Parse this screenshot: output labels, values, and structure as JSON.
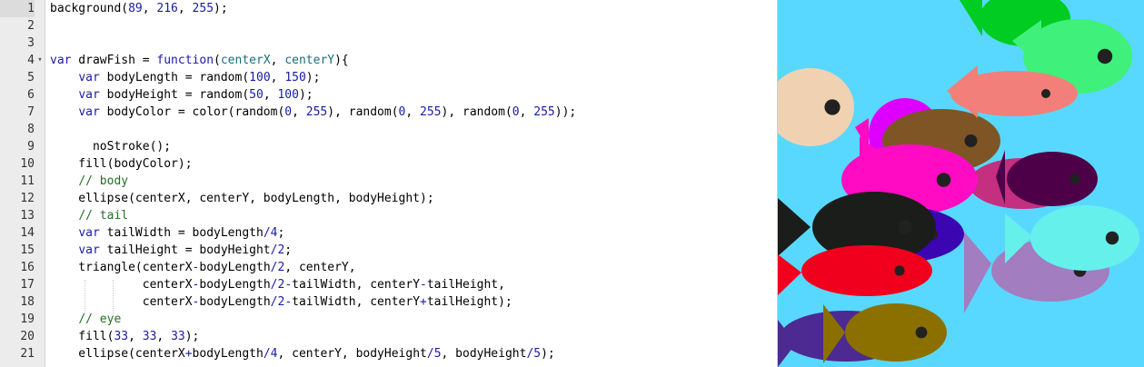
{
  "editor": {
    "active_line": 1,
    "lines": [
      {
        "n": "1",
        "tokens": [
          {
            "t": "background(",
            "c": ""
          },
          {
            "t": "89",
            "c": "num"
          },
          {
            "t": ", ",
            "c": ""
          },
          {
            "t": "216",
            "c": "num"
          },
          {
            "t": ", ",
            "c": ""
          },
          {
            "t": "255",
            "c": "num"
          },
          {
            "t": ");",
            "c": ""
          }
        ]
      },
      {
        "n": "2",
        "tokens": []
      },
      {
        "n": "3",
        "tokens": []
      },
      {
        "n": "4",
        "fold": "▾",
        "tokens": [
          {
            "t": "var",
            "c": "kw"
          },
          {
            "t": " drawFish = ",
            "c": ""
          },
          {
            "t": "function",
            "c": "kw"
          },
          {
            "t": "(",
            "c": ""
          },
          {
            "t": "centerX",
            "c": "param"
          },
          {
            "t": ", ",
            "c": ""
          },
          {
            "t": "centerY",
            "c": "param"
          },
          {
            "t": "){",
            "c": ""
          }
        ]
      },
      {
        "n": "5",
        "tokens": [
          {
            "t": "    ",
            "c": ""
          },
          {
            "t": "var",
            "c": "kw"
          },
          {
            "t": " bodyLength = random(",
            "c": ""
          },
          {
            "t": "100",
            "c": "num"
          },
          {
            "t": ", ",
            "c": ""
          },
          {
            "t": "150",
            "c": "num"
          },
          {
            "t": ");",
            "c": ""
          }
        ]
      },
      {
        "n": "6",
        "tokens": [
          {
            "t": "    ",
            "c": ""
          },
          {
            "t": "var",
            "c": "kw"
          },
          {
            "t": " bodyHeight = random(",
            "c": ""
          },
          {
            "t": "50",
            "c": "num"
          },
          {
            "t": ", ",
            "c": ""
          },
          {
            "t": "100",
            "c": "num"
          },
          {
            "t": ");",
            "c": ""
          }
        ]
      },
      {
        "n": "7",
        "tokens": [
          {
            "t": "    ",
            "c": ""
          },
          {
            "t": "var",
            "c": "kw"
          },
          {
            "t": " bodyColor = color(random(",
            "c": ""
          },
          {
            "t": "0",
            "c": "num"
          },
          {
            "t": ", ",
            "c": ""
          },
          {
            "t": "255",
            "c": "num"
          },
          {
            "t": "), random(",
            "c": ""
          },
          {
            "t": "0",
            "c": "num"
          },
          {
            "t": ", ",
            "c": ""
          },
          {
            "t": "255",
            "c": "num"
          },
          {
            "t": "), random(",
            "c": ""
          },
          {
            "t": "0",
            "c": "num"
          },
          {
            "t": ", ",
            "c": ""
          },
          {
            "t": "255",
            "c": "num"
          },
          {
            "t": "));",
            "c": ""
          }
        ]
      },
      {
        "n": "8",
        "tokens": []
      },
      {
        "n": "9",
        "tokens": [
          {
            "t": "      noStroke();",
            "c": ""
          }
        ]
      },
      {
        "n": "10",
        "tokens": [
          {
            "t": "    fill(bodyColor);",
            "c": ""
          }
        ]
      },
      {
        "n": "11",
        "tokens": [
          {
            "t": "    ",
            "c": ""
          },
          {
            "t": "// body",
            "c": "cmt"
          }
        ]
      },
      {
        "n": "12",
        "tokens": [
          {
            "t": "    ellipse(centerX, centerY, bodyLength, bodyHeight);",
            "c": ""
          }
        ]
      },
      {
        "n": "13",
        "tokens": [
          {
            "t": "    ",
            "c": ""
          },
          {
            "t": "// tail",
            "c": "cmt"
          }
        ]
      },
      {
        "n": "14",
        "tokens": [
          {
            "t": "    ",
            "c": ""
          },
          {
            "t": "var",
            "c": "kw"
          },
          {
            "t": " tailWidth = bodyLength",
            "c": ""
          },
          {
            "t": "/",
            "c": "op"
          },
          {
            "t": "4",
            "c": "num"
          },
          {
            "t": ";",
            "c": ""
          }
        ]
      },
      {
        "n": "15",
        "tokens": [
          {
            "t": "    ",
            "c": ""
          },
          {
            "t": "var",
            "c": "kw"
          },
          {
            "t": " tailHeight = bodyHeight",
            "c": ""
          },
          {
            "t": "/",
            "c": "op"
          },
          {
            "t": "2",
            "c": "num"
          },
          {
            "t": ";",
            "c": ""
          }
        ]
      },
      {
        "n": "16",
        "tokens": [
          {
            "t": "    triangle(centerX",
            "c": ""
          },
          {
            "t": "-",
            "c": "op"
          },
          {
            "t": "bodyLength",
            "c": ""
          },
          {
            "t": "/",
            "c": "op"
          },
          {
            "t": "2",
            "c": "num"
          },
          {
            "t": ", centerY,",
            "c": ""
          }
        ]
      },
      {
        "n": "17",
        "tokens": [
          {
            "t": "             centerX",
            "c": ""
          },
          {
            "t": "-",
            "c": "op"
          },
          {
            "t": "bodyLength",
            "c": ""
          },
          {
            "t": "/",
            "c": "op"
          },
          {
            "t": "2",
            "c": "num"
          },
          {
            "t": "-",
            "c": "op"
          },
          {
            "t": "tailWidth, centerY",
            "c": ""
          },
          {
            "t": "-",
            "c": "op"
          },
          {
            "t": "tailHeight,",
            "c": ""
          }
        ]
      },
      {
        "n": "18",
        "tokens": [
          {
            "t": "             centerX",
            "c": ""
          },
          {
            "t": "-",
            "c": "op"
          },
          {
            "t": "bodyLength",
            "c": ""
          },
          {
            "t": "/",
            "c": "op"
          },
          {
            "t": "2",
            "c": "num"
          },
          {
            "t": "-",
            "c": "op"
          },
          {
            "t": "tailWidth, centerY",
            "c": ""
          },
          {
            "t": "+",
            "c": "op"
          },
          {
            "t": "tailHeight);",
            "c": ""
          }
        ]
      },
      {
        "n": "19",
        "tokens": [
          {
            "t": "    ",
            "c": ""
          },
          {
            "t": "// eye",
            "c": "cmt"
          }
        ]
      },
      {
        "n": "20",
        "tokens": [
          {
            "t": "    fill(",
            "c": ""
          },
          {
            "t": "33",
            "c": "num"
          },
          {
            "t": ", ",
            "c": ""
          },
          {
            "t": "33",
            "c": "num"
          },
          {
            "t": ", ",
            "c": ""
          },
          {
            "t": "33",
            "c": "num"
          },
          {
            "t": ");",
            "c": ""
          }
        ]
      },
      {
        "n": "21",
        "tokens": [
          {
            "t": "    ellipse(centerX",
            "c": ""
          },
          {
            "t": "+",
            "c": "op"
          },
          {
            "t": "bodyLength",
            "c": ""
          },
          {
            "t": "/",
            "c": "op"
          },
          {
            "t": "4",
            "c": "num"
          },
          {
            "t": ", centerY, bodyHeight",
            "c": ""
          },
          {
            "t": "/",
            "c": "op"
          },
          {
            "t": "5",
            "c": "num"
          },
          {
            "t": ", bodyHeight",
            "c": ""
          },
          {
            "t": "/",
            "c": "op"
          },
          {
            "t": "5",
            "c": "num"
          },
          {
            "t": ");",
            "c": ""
          }
        ]
      }
    ]
  },
  "canvas": {
    "background": "#59d8ff",
    "eye_color": "#212121"
  }
}
